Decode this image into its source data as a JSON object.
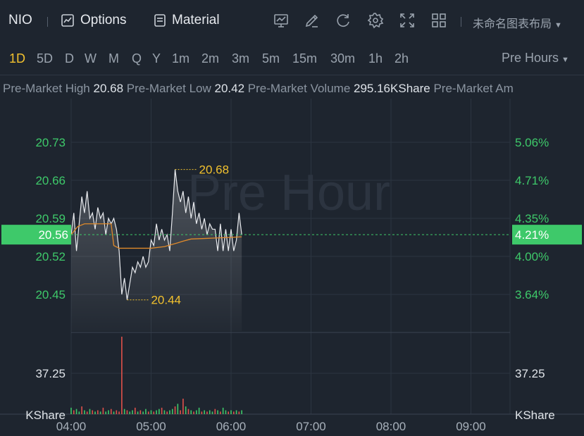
{
  "header": {
    "symbol": "NIO",
    "options_label": "Options",
    "material_label": "Material",
    "layout_label": "未命名图表布局",
    "toolbar_icons": [
      "chart-settings-icon",
      "draw-icon",
      "refresh-icon",
      "settings-icon",
      "fullscreen-icon",
      "grid-layout-icon"
    ]
  },
  "periods": {
    "items": [
      "1D",
      "5D",
      "D",
      "W",
      "M",
      "Q",
      "Y",
      "1m",
      "2m",
      "3m",
      "5m",
      "15m",
      "30m",
      "1h",
      "2h"
    ],
    "active": "1D",
    "session_label": "Pre Hours"
  },
  "stats": {
    "high_label": "Pre-Market High",
    "high_value": "20.68",
    "low_label": "Pre-Market Low",
    "low_value": "20.42",
    "volume_label": "Pre-Market Volume",
    "volume_value": "295.16KShare",
    "amount_label": "Pre-Market Am"
  },
  "colors": {
    "price_line": "#e8eaee",
    "avg_line": "#e08a2a",
    "axis_text": "#3ec96a",
    "highlight": "#3ec96a",
    "annotation": "#f2c12e",
    "vol_up": "#3ec96a",
    "vol_down": "#e0514a"
  },
  "chart_data": {
    "type": "line",
    "watermark": "Pre Hour",
    "x_ticks": [
      "04:00",
      "05:00",
      "06:00",
      "07:00",
      "08:00",
      "09:00"
    ],
    "x_range_minutes": [
      0,
      300
    ],
    "y_left_ticks": [
      "20.73",
      "20.66",
      "20.59",
      "20.52",
      "20.45"
    ],
    "y_left_values": [
      20.73,
      20.66,
      20.59,
      20.52,
      20.45
    ],
    "y_right_ticks": [
      "5.06%",
      "4.71%",
      "4.35%",
      "4.00%",
      "3.64%"
    ],
    "y_range": [
      20.45,
      20.73
    ],
    "current_price": "20.56",
    "current_pct": "4.21%",
    "high_annotation": "20.68",
    "low_annotation": "20.44",
    "volume_tick": "37.25",
    "volume_unit": "KShare",
    "series": [
      {
        "time_minutes": [
          0,
          2,
          4,
          6,
          8,
          10,
          12,
          14,
          16,
          18,
          20,
          22,
          24,
          26,
          28,
          30,
          32,
          34,
          36,
          38,
          40,
          42,
          44,
          46,
          48,
          50,
          52,
          54,
          56,
          58,
          60,
          62,
          64,
          66,
          68,
          70,
          72,
          74,
          76,
          78,
          80,
          82,
          84,
          86,
          88,
          90,
          92,
          94,
          96,
          98,
          100,
          102,
          104,
          106,
          108,
          110,
          112,
          114,
          116,
          118,
          120,
          122,
          124,
          126,
          128
        ],
        "price": [
          20.56,
          20.6,
          20.53,
          20.58,
          20.63,
          20.6,
          20.64,
          20.59,
          20.6,
          20.57,
          20.61,
          20.59,
          20.6,
          20.56,
          20.59,
          20.58,
          20.59,
          20.57,
          20.53,
          20.45,
          20.48,
          20.44,
          20.47,
          20.5,
          20.49,
          20.51,
          20.5,
          20.52,
          20.5,
          20.51,
          20.55,
          20.54,
          20.58,
          20.55,
          20.57,
          20.55,
          20.56,
          20.53,
          20.6,
          20.68,
          20.64,
          20.62,
          20.64,
          20.6,
          20.63,
          20.59,
          20.62,
          20.58,
          20.6,
          20.57,
          20.59,
          20.56,
          20.58,
          20.57,
          20.57,
          20.53,
          20.58,
          20.53,
          20.57,
          20.53,
          20.57,
          20.53,
          20.55,
          20.6,
          20.56
        ]
      },
      {
        "name": "",
        "time_minutes": [
          0,
          5,
          10,
          20,
          30,
          32,
          36,
          40,
          50,
          60,
          70,
          80,
          84,
          90,
          100,
          110,
          120,
          128
        ],
        "price": [
          20.56,
          20.575,
          20.58,
          20.58,
          20.58,
          20.54,
          20.535,
          20.535,
          20.535,
          20.535,
          20.538,
          20.545,
          20.548,
          20.552,
          20.553,
          20.554,
          20.555,
          20.556
        ]
      }
    ],
    "volume": {
      "time_minutes": [
        0,
        2,
        4,
        6,
        8,
        10,
        12,
        14,
        16,
        18,
        20,
        22,
        24,
        26,
        28,
        30,
        32,
        34,
        36,
        38,
        40,
        42,
        44,
        46,
        48,
        50,
        52,
        54,
        56,
        58,
        60,
        62,
        64,
        66,
        68,
        70,
        72,
        74,
        76,
        78,
        80,
        82,
        84,
        86,
        88,
        90,
        92,
        94,
        96,
        98,
        100,
        102,
        104,
        106,
        108,
        110,
        112,
        114,
        116,
        118,
        120,
        122,
        124,
        126,
        128
      ],
      "values": [
        5,
        3,
        4,
        2,
        6,
        3,
        2,
        4,
        3,
        2,
        3,
        2,
        5,
        2,
        3,
        4,
        2,
        3,
        2,
        60,
        4,
        3,
        2,
        3,
        5,
        2,
        3,
        2,
        4,
        2,
        3,
        2,
        3,
        4,
        5,
        3,
        2,
        3,
        4,
        6,
        8,
        3,
        12,
        6,
        4,
        3,
        2,
        3,
        5,
        2,
        3,
        2,
        3,
        2,
        4,
        3,
        2,
        5,
        3,
        2,
        3,
        2,
        3,
        2,
        3
      ],
      "up": [
        true,
        false,
        true,
        true,
        false,
        true,
        false,
        true,
        false,
        true,
        false,
        true,
        false,
        true,
        true,
        false,
        true,
        false,
        false,
        false,
        true,
        false,
        true,
        true,
        false,
        true,
        false,
        true,
        true,
        false,
        true,
        false,
        true,
        true,
        false,
        true,
        false,
        true,
        true,
        false,
        true,
        false,
        false,
        true,
        false,
        true,
        false,
        true,
        true,
        false,
        true,
        false,
        true,
        true,
        false,
        true,
        false,
        true,
        true,
        false,
        true,
        false,
        true,
        false,
        true
      ]
    }
  }
}
